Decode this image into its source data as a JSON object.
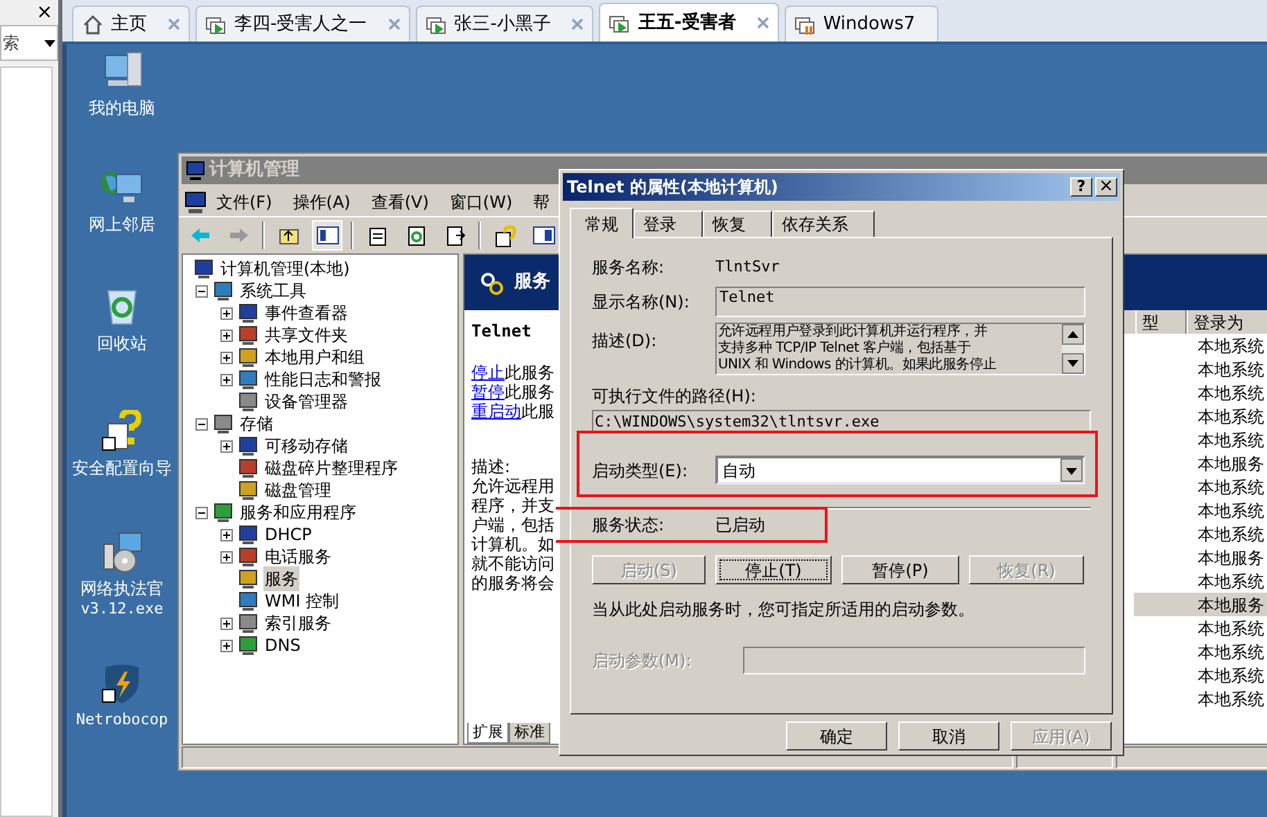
{
  "left_panel": {
    "close_glyph": "×",
    "dropdown": {
      "value": "索"
    }
  },
  "browser_tabs": [
    {
      "label": "主页",
      "kind": "home",
      "selected": false,
      "closable": true
    },
    {
      "label": "李四-受害人之一",
      "kind": "vm",
      "selected": false,
      "closable": true
    },
    {
      "label": "张三-小黑子",
      "kind": "vm",
      "selected": false,
      "closable": true
    },
    {
      "label": "王五-受害者",
      "kind": "vm",
      "selected": true,
      "closable": true
    },
    {
      "label": "Windows7",
      "kind": "vm_off",
      "selected": false,
      "closable": false
    }
  ],
  "desktop_icons": [
    {
      "lines": [
        "我的电脑"
      ],
      "kind": "computer"
    },
    {
      "lines": [
        "网上邻居"
      ],
      "kind": "network"
    },
    {
      "lines": [
        "回收站"
      ],
      "kind": "recycle"
    },
    {
      "lines": [
        "安全配置向导"
      ],
      "kind": "wizard"
    },
    {
      "lines": [
        "网络执法官",
        "v3.12.exe"
      ],
      "kind": "installer"
    },
    {
      "lines": [
        "Netrobocop"
      ],
      "kind": "shield"
    }
  ],
  "computer_management": {
    "title": "计算机管理",
    "menu": [
      "文件(F)",
      "操作(A)",
      "查看(V)",
      "窗口(W)",
      "帮"
    ],
    "tree": [
      {
        "label": "计算机管理(本地)",
        "expandable": false,
        "selected": false,
        "children": [
          {
            "label": "系统工具",
            "expandable": true,
            "expanded": true,
            "selected": false,
            "children": [
              {
                "label": "事件查看器",
                "expandable": true,
                "expanded": false,
                "selected": false
              },
              {
                "label": "共享文件夹",
                "expandable": true,
                "expanded": false,
                "selected": false
              },
              {
                "label": "本地用户和组",
                "expandable": true,
                "expanded": false,
                "selected": false
              },
              {
                "label": "性能日志和警报",
                "expandable": true,
                "expanded": false,
                "selected": false
              },
              {
                "label": "设备管理器",
                "expandable": false,
                "selected": false
              }
            ]
          },
          {
            "label": "存储",
            "expandable": true,
            "expanded": true,
            "selected": false,
            "children": [
              {
                "label": "可移动存储",
                "expandable": true,
                "expanded": false,
                "selected": false
              },
              {
                "label": "磁盘碎片整理程序",
                "expandable": false,
                "selected": false
              },
              {
                "label": "磁盘管理",
                "expandable": false,
                "selected": false
              }
            ]
          },
          {
            "label": "服务和应用程序",
            "expandable": true,
            "expanded": true,
            "selected": false,
            "children": [
              {
                "label": "DHCP",
                "expandable": true,
                "expanded": false,
                "selected": false
              },
              {
                "label": "电话服务",
                "expandable": true,
                "expanded": false,
                "selected": false
              },
              {
                "label": "服务",
                "expandable": false,
                "selected": true
              },
              {
                "label": "WMI 控制",
                "expandable": false,
                "selected": false
              },
              {
                "label": "索引服务",
                "expandable": true,
                "expanded": false,
                "selected": false
              },
              {
                "label": "DNS",
                "expandable": true,
                "expanded": false,
                "selected": false
              }
            ]
          }
        ]
      }
    ],
    "pane_header": "服务",
    "detail": {
      "title": "Telnet",
      "actions": [
        {
          "link": "停止",
          "text": "此服务"
        },
        {
          "link": "暂停",
          "text": "此服务"
        },
        {
          "link": "重启动",
          "text": "此服"
        }
      ],
      "description_label": "描述:",
      "description_lines": [
        "允许远程用",
        "程序，并支",
        "户端，包括",
        "计算机。如",
        "就不能访问",
        "的服务将会"
      ]
    },
    "list": {
      "columns": [
        "型",
        "登录为"
      ],
      "rows": [
        {
          "log_on_as": "本地系统",
          "selected": false
        },
        {
          "log_on_as": "本地系统",
          "selected": false
        },
        {
          "log_on_as": "本地系统",
          "selected": false
        },
        {
          "log_on_as": "本地系统",
          "selected": false
        },
        {
          "log_on_as": "本地系统",
          "selected": false
        },
        {
          "log_on_as": "本地服务",
          "selected": false
        },
        {
          "log_on_as": "本地系统",
          "selected": false
        },
        {
          "log_on_as": "本地系统",
          "selected": false
        },
        {
          "log_on_as": "本地系统",
          "selected": false
        },
        {
          "log_on_as": "本地服务",
          "selected": false
        },
        {
          "log_on_as": "本地系统",
          "selected": false
        },
        {
          "log_on_as": "本地服务",
          "selected": true
        },
        {
          "log_on_as": "本地系统",
          "selected": false
        },
        {
          "log_on_as": "本地系统",
          "selected": false
        },
        {
          "log_on_as": "本地系统",
          "selected": false
        },
        {
          "log_on_as": "本地系统",
          "selected": false
        }
      ]
    },
    "bottom_tabs": [
      {
        "label": "扩展",
        "selected": true
      },
      {
        "label": "标准",
        "selected": false
      }
    ]
  },
  "dialog": {
    "title": "Telnet 的属性(本地计算机)",
    "help_glyph": "?",
    "close_glyph": "×",
    "tabs": [
      {
        "label": "常规",
        "selected": true
      },
      {
        "label": "登录",
        "selected": false
      },
      {
        "label": "恢复",
        "selected": false
      },
      {
        "label": "依存关系",
        "selected": false
      }
    ],
    "service_name": {
      "label": "服务名称:",
      "value": "TlntSvr"
    },
    "display_name": {
      "label": "显示名称(N):",
      "value": "Telnet"
    },
    "description": {
      "label": "描述(D):",
      "lines": [
        "允许远程用户登录到此计算机并运行程序，并",
        "支持多种 TCP/IP Telnet 客户端，包括基于",
        "UNIX 和 Windows 的计算机。如果此服务停止"
      ]
    },
    "path": {
      "label": "可执行文件的路径(H):",
      "value": "C:\\WINDOWS\\system32\\tlntsvr.exe"
    },
    "startup_type": {
      "label": "启动类型(E):",
      "value": "自动"
    },
    "status": {
      "label": "服务状态:",
      "value": "已启动"
    },
    "service_buttons": [
      {
        "label": "启动(S)",
        "disabled": true,
        "focused": false
      },
      {
        "label": "停止(T)",
        "disabled": false,
        "focused": true
      },
      {
        "label": "暂停(P)",
        "disabled": false,
        "focused": false
      },
      {
        "label": "恢复(R)",
        "disabled": true,
        "focused": false
      }
    ],
    "hint": "当从此处启动服务时，您可指定所适用的启动参数。",
    "start_params": {
      "label": "启动参数(M):",
      "disabled": true
    },
    "buttons": [
      {
        "label": "确定",
        "disabled": false
      },
      {
        "label": "取消",
        "disabled": false
      },
      {
        "label": "应用(A)",
        "disabled": true
      }
    ]
  }
}
